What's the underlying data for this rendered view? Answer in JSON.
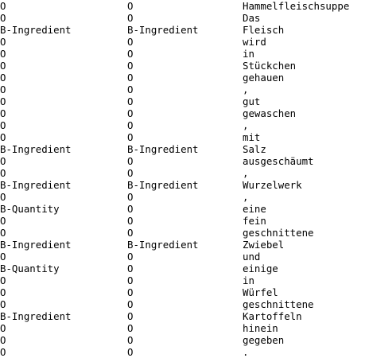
{
  "rows": [
    [
      "O",
      "O",
      "Hammelfleischsuppe"
    ],
    [
      "O",
      "O",
      "Das"
    ],
    [
      "B-Ingredient",
      "B-Ingredient",
      "Fleisch"
    ],
    [
      "O",
      "O",
      "wird"
    ],
    [
      "O",
      "O",
      "in"
    ],
    [
      "O",
      "O",
      "Stückchen"
    ],
    [
      "O",
      "O",
      "gehauen"
    ],
    [
      "O",
      "O",
      ","
    ],
    [
      "O",
      "O",
      "gut"
    ],
    [
      "O",
      "O",
      "gewaschen"
    ],
    [
      "O",
      "O",
      ","
    ],
    [
      "O",
      "O",
      "mit"
    ],
    [
      "B-Ingredient",
      "B-Ingredient",
      "Salz"
    ],
    [
      "O",
      "O",
      "ausgeschäumt"
    ],
    [
      "O",
      "O",
      ","
    ],
    [
      "B-Ingredient",
      "B-Ingredient",
      "Wurzelwerk"
    ],
    [
      "O",
      "O",
      ","
    ],
    [
      "B-Quantity",
      "O",
      "eine"
    ],
    [
      "O",
      "O",
      "fein"
    ],
    [
      "O",
      "O",
      "geschnittene"
    ],
    [
      "B-Ingredient",
      "B-Ingredient",
      "Zwiebel"
    ],
    [
      "O",
      "O",
      "und"
    ],
    [
      "B-Quantity",
      "O",
      "einige"
    ],
    [
      "O",
      "O",
      "in"
    ],
    [
      "O",
      "O",
      "Würfel"
    ],
    [
      "O",
      "O",
      "geschnittene"
    ],
    [
      "B-Ingredient",
      "O",
      "Kartoffeln"
    ],
    [
      "O",
      "O",
      "hinein"
    ],
    [
      "O",
      "O",
      "gegeben"
    ],
    [
      "O",
      "O",
      "."
    ]
  ]
}
